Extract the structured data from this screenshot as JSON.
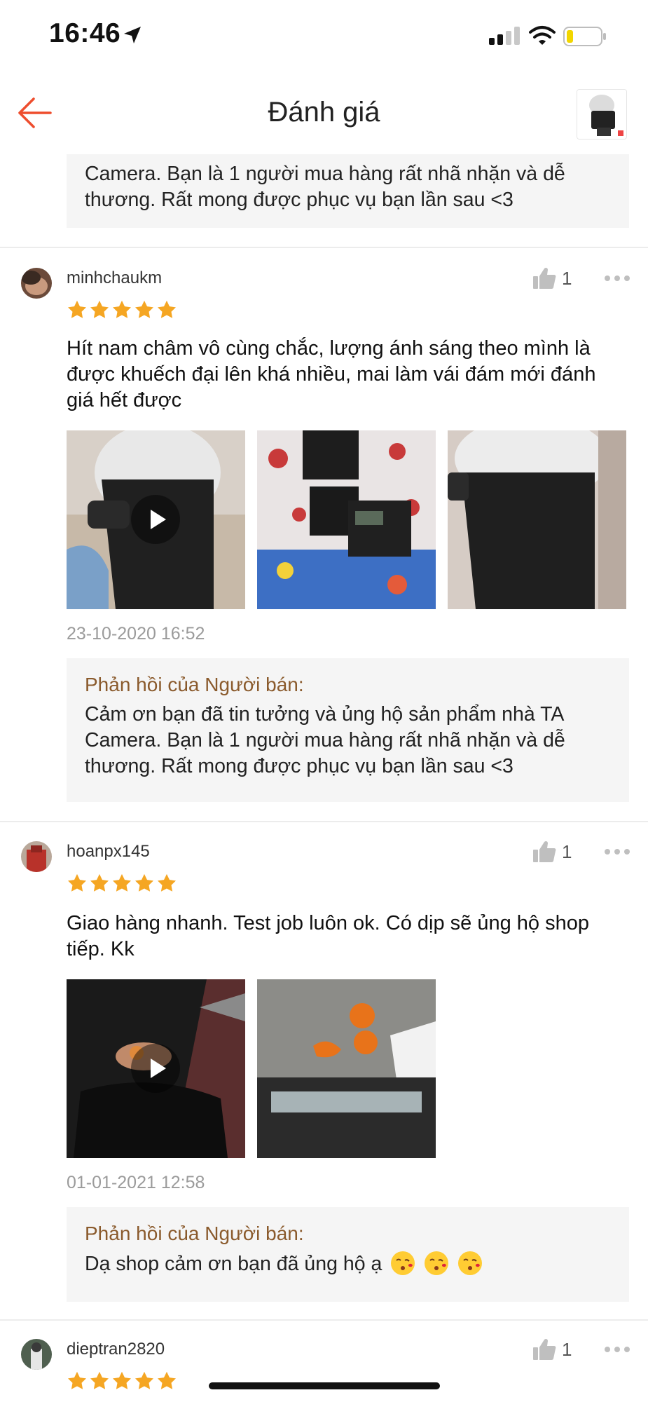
{
  "status_bar": {
    "time": "16:46"
  },
  "header": {
    "title": "Đánh giá"
  },
  "top_partial_reply": {
    "lines": [
      "Camera. Bạn là 1 người mua hàng rất nhã nhặn và dễ",
      "thương. Rất mong được phục vụ bạn lần sau <3"
    ]
  },
  "reviews": [
    {
      "username": "minhchaukm",
      "rating": 5,
      "likes": "1",
      "text_lines": [
        "Hít nam châm vô cùng chắc, lượng ánh sáng theo mình là",
        "được khuếch đại lên khá nhiều, mai làm vái đám mới đánh",
        "giá hết được"
      ],
      "date": "23-10-2020 16:52",
      "reply_title": "Phản hồi của Người bán:",
      "reply_lines": [
        "Cảm ơn bạn đã tin tưởng và ủng hộ sản phẩm nhà TA",
        "Camera. Bạn là 1 người mua hàng rất nhã nhặn và dễ",
        "thương. Rất mong được phục vụ bạn lần sau <3"
      ]
    },
    {
      "username": "hoanpx145",
      "rating": 5,
      "likes": "1",
      "text_lines": [
        "Giao hàng nhanh. Test job luôn ok. Có dịp sẽ ủng hộ shop",
        "tiếp. Kk"
      ],
      "date": "01-01-2021 12:58",
      "reply_title": "Phản hồi của Người bán:",
      "reply_lines": [
        "Dạ shop cảm ơn bạn đã ủng hộ ạ"
      ]
    },
    {
      "username": "dieptran2820",
      "rating": 5,
      "likes": "1"
    }
  ],
  "colors": {
    "accent": "#ee4d2d",
    "star": "#f5a623",
    "reply_title": "#8a5a2c",
    "reply_bg": "#f5f5f5",
    "date": "#9b9b9b"
  },
  "icons": {
    "back": "arrow-left-icon",
    "like": "thumbs-up-icon",
    "more": "ellipsis-icon",
    "play": "play-icon",
    "emoji": "kissing-face-icon"
  }
}
